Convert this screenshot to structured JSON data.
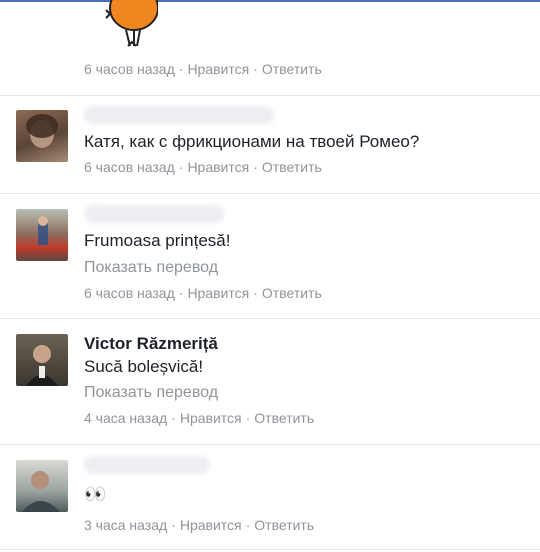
{
  "comments": [
    {
      "author": "",
      "text": "",
      "translate": "",
      "time": "6 часов назад",
      "like": "Нравится",
      "reply": "Ответить"
    },
    {
      "author": "",
      "text": "Катя, как с фрикционами на твоей Ромео?",
      "translate": "",
      "time": "6 часов назад",
      "like": "Нравится",
      "reply": "Ответить"
    },
    {
      "author": "",
      "text": "Frumoasa prințesă!",
      "translate": "Показать перевод",
      "time": "6 часов назад",
      "like": "Нравится",
      "reply": "Ответить"
    },
    {
      "author": "Victor Răzmeriță",
      "text": "Sucă boleșvică!",
      "translate": "Показать перевод",
      "time": "4 часа назад",
      "like": "Нравится",
      "reply": "Ответить"
    },
    {
      "author": "",
      "text": "👀",
      "translate": "",
      "time": "3 часа назад",
      "like": "Нравится",
      "reply": "Ответить"
    }
  ],
  "separator": "·",
  "colors": {
    "text": "#1d2129",
    "meta": "#90949c",
    "divider": "#e4e6ea",
    "accent": "#4a6fc0"
  }
}
